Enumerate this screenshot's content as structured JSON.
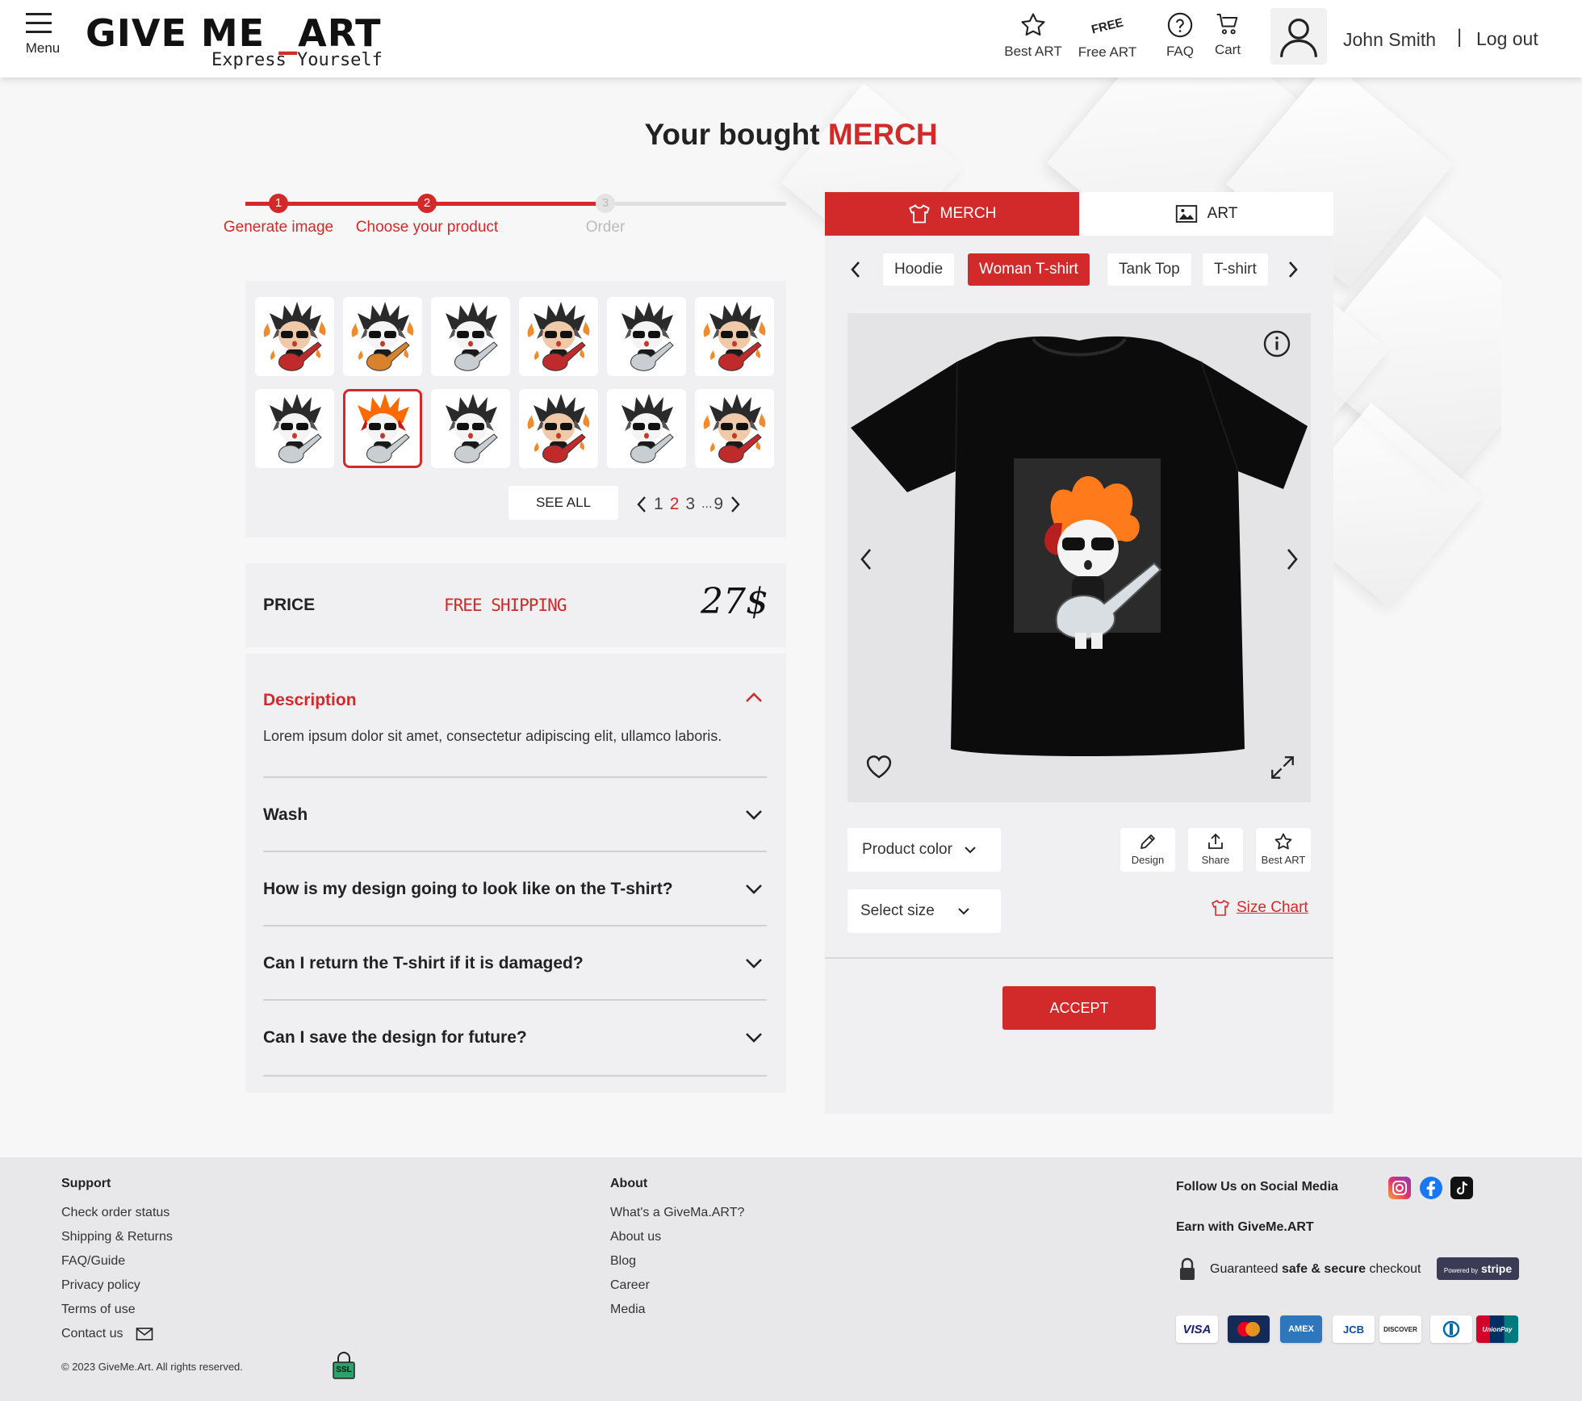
{
  "header": {
    "menu_label": "Menu",
    "logo_main": "GIVE ME",
    "logo_dash": "_",
    "logo_art": "ART",
    "logo_tagline": "Express Yourself",
    "nav": [
      {
        "label": "Best ART",
        "icon": "star-icon"
      },
      {
        "label": "Free ART",
        "icon": "free-badge-icon",
        "badge": "FREE"
      },
      {
        "label": "FAQ",
        "icon": "question-circle-icon"
      },
      {
        "label": "Cart",
        "icon": "cart-icon"
      }
    ],
    "user_name": "John Smith",
    "separator": "|",
    "logout_label": "Log out"
  },
  "page": {
    "title_prefix": "Your bought ",
    "title_accent": "MERCH"
  },
  "stepper": {
    "steps": [
      {
        "num": "1",
        "label": "Generate image",
        "state": "done"
      },
      {
        "num": "2",
        "label": "Choose your product",
        "state": "active"
      },
      {
        "num": "3",
        "label": "Order",
        "state": "pending"
      }
    ],
    "progress": 0.667
  },
  "gallery": {
    "selected_index": 7,
    "see_all_label": "SEE ALL",
    "pages": [
      "1",
      "2",
      "3",
      "...",
      "9"
    ],
    "current_page": "2"
  },
  "price": {
    "label": "PRICE",
    "shipping": "FREE SHIPPING",
    "value": "27$"
  },
  "accordion": {
    "description_title": "Description",
    "description_text": "Lorem ipsum dolor sit amet, consectetur adipiscing elit, ullamco laboris.",
    "items": [
      "Wash",
      "How is my design going to look like on the T-shirt?",
      "Can I return the T-shirt if it is damaged?",
      "Can I save the design for future?"
    ]
  },
  "panel": {
    "tab_merch": "MERCH",
    "tab_art": "ART",
    "product_tabs": [
      "Hoodie",
      "Woman T-shirt",
      "Tank Top",
      "T-shirt"
    ],
    "active_product": "Woman T-shirt",
    "product_color_label": "Product color",
    "select_size_label": "Select size",
    "actions": [
      "Design",
      "Share",
      "Best ART"
    ],
    "size_chart_label": "Size Chart",
    "accept_label": "ACCEPT"
  },
  "footer": {
    "support_title": "Support",
    "support_links": [
      "Check order status",
      "Shipping & Returns",
      "FAQ/Guide",
      "Privacy policy",
      "Terms of use",
      "Contact us"
    ],
    "about_title": "About",
    "about_links": [
      "What's a GiveMa.ART?",
      "About us",
      "Blog",
      "Career",
      "Media"
    ],
    "follow_label": "Follow Us on Social Media",
    "earn_label": "Earn with GiveMe.ART",
    "checkout_prefix": "Guaranteed ",
    "checkout_bold": "safe & secure",
    "checkout_suffix": " checkout",
    "stripe_small": "Powered by",
    "stripe_label": "stripe",
    "copyright": "© 2023 GiveMe.Art. All rights reserved.",
    "ssl_label": "SSL",
    "cards": [
      "VISA",
      "MC",
      "AMEX",
      "JCB",
      "DISCOVER",
      "DINERS",
      "UnionPay"
    ]
  },
  "colors": {
    "accent": "#d22a2a",
    "panel_bg": "#f0f0f2",
    "footer_bg": "#e8e8ea"
  }
}
